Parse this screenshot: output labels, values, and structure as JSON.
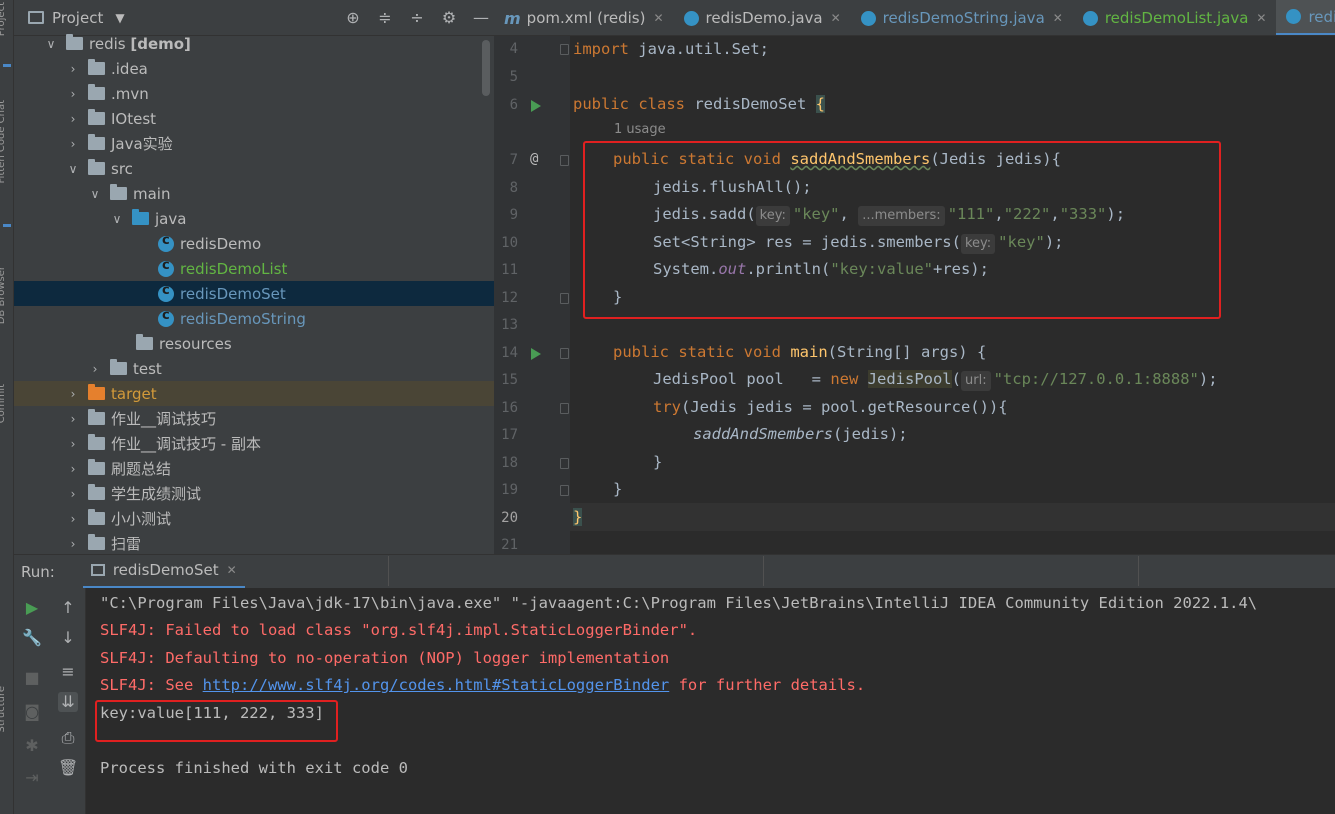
{
  "left_strip": {
    "labels": [
      "Project",
      "Fitten Code Chat",
      "DB Browser",
      "Commit",
      "Structure"
    ]
  },
  "project_panel": {
    "title": "Project",
    "root": {
      "name": "redis",
      "module": "[demo]"
    },
    "items": [
      {
        "label": ".idea"
      },
      {
        "label": ".mvn"
      },
      {
        "label": "IOtest"
      },
      {
        "label": "Java实验"
      },
      {
        "label": "src"
      },
      {
        "label": "main"
      },
      {
        "label": "java"
      },
      {
        "label": "redisDemo"
      },
      {
        "label": "redisDemoList"
      },
      {
        "label": "redisDemoSet"
      },
      {
        "label": "redisDemoString"
      },
      {
        "label": "resources"
      },
      {
        "label": "test"
      },
      {
        "label": "target"
      },
      {
        "label": "作业__调试技巧"
      },
      {
        "label": "作业__调试技巧 - 副本"
      },
      {
        "label": "刷题总结"
      },
      {
        "label": "学生成绩测试"
      },
      {
        "label": "小小测试"
      },
      {
        "label": "扫雷"
      }
    ]
  },
  "editor": {
    "tabs": [
      {
        "label": "pom.xml (redis)"
      },
      {
        "label": "redisDemo.java"
      },
      {
        "label": "redisDemoString.java"
      },
      {
        "label": "redisDemoList.java"
      },
      {
        "label": "redisDe"
      }
    ],
    "usage_hint": "1 usage",
    "line_numbers": [
      "4",
      "5",
      "6",
      "7",
      "8",
      "9",
      "10",
      "11",
      "12",
      "13",
      "14",
      "15",
      "16",
      "17",
      "18",
      "19",
      "20",
      "21"
    ],
    "code": {
      "l4_kw": "import",
      "l4_rest": " java.util.Set;",
      "l6_kw": "public class",
      "l6_name": " redisDemoSet ",
      "l6_brace": "{",
      "l7_kw": "public static void",
      "l7_fn": "saddAndSmembers",
      "l7_rest": "(Jedis jedis){",
      "l8": "jedis.flushAll();",
      "l9_a": "jedis.sadd(",
      "l9_hint1": "key:",
      "l9_s1": "\"key\"",
      "l9_c": ", ",
      "l9_hint2": "...members:",
      "l9_s2": "\"111\"",
      "l9_c2": ",",
      "l9_s3": "\"222\"",
      "l9_c3": ",",
      "l9_s4": "\"333\"",
      "l9_end": ");",
      "l10_a": "Set<String> res = jedis.smembers(",
      "l10_hint": "key:",
      "l10_s": "\"key\"",
      "l10_end": ");",
      "l11_a": "System.",
      "l11_fld": "out",
      "l11_b": ".println(",
      "l11_s": "\"key:value\"",
      "l11_end": "+res);",
      "l12": "}",
      "l14_kw": "public static void",
      "l14_fn": "main",
      "l14_rest": "(String[] args) {",
      "l15_a": "JedisPool pool   = ",
      "l15_kw": "new",
      "l15_cls": "JedisPool",
      "l15_b": "(",
      "l15_hint": "url:",
      "l15_s": "\"tcp://127.0.0.1:8888\"",
      "l15_end": ");",
      "l16_kw": "try",
      "l16_rest": "(Jedis jedis = pool.getResource()){",
      "l17": "saddAndSmembers",
      "l17_end": "(jedis);",
      "l18": "}",
      "l19": "}",
      "l20": "}"
    }
  },
  "run_panel": {
    "label": "Run:",
    "tab": "redisDemoSet",
    "console": {
      "line1": "\"C:\\Program Files\\Java\\jdk-17\\bin\\java.exe\" \"-javaagent:C:\\Program Files\\JetBrains\\IntelliJ IDEA Community Edition 2022.1.4\\",
      "line2": "SLF4J: Failed to load class \"org.slf4j.impl.StaticLoggerBinder\".",
      "line3": "SLF4J: Defaulting to no-operation (NOP) logger implementation",
      "line4_a": "SLF4J: See ",
      "line4_link": "http://www.slf4j.org/codes.html#StaticLoggerBinder",
      "line4_b": " for further details.",
      "line5": "key:value[111, 222, 333]",
      "line6": "Process finished with exit code 0"
    }
  },
  "colors": {
    "keyword": "#cc7832",
    "function": "#ffc66d",
    "string": "#6a8759",
    "error": "#ff6b68",
    "link": "#5394ec",
    "annotation_box": "#e02020"
  }
}
